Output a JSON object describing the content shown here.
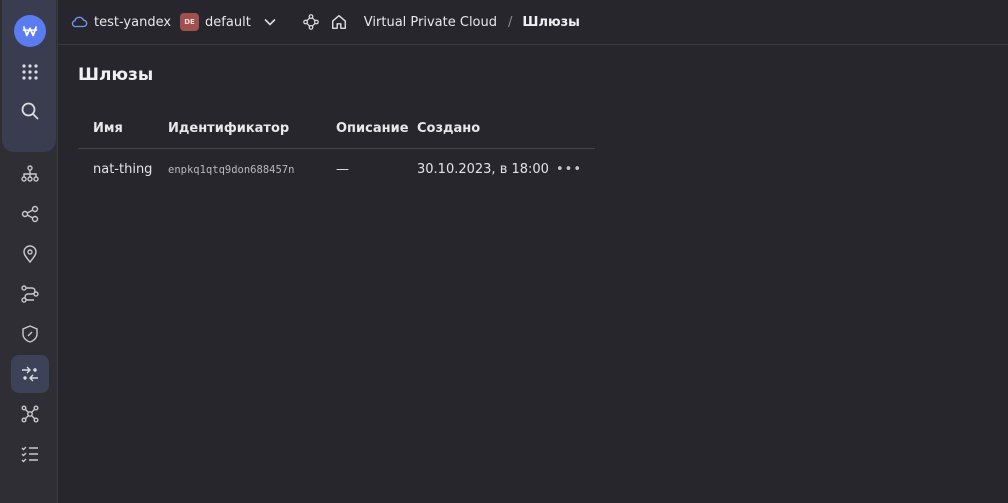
{
  "header": {
    "cloud_name": "test-yandex",
    "folder_badge": "DE",
    "folder_name": "default",
    "breadcrumb_service": "Virtual Private Cloud",
    "breadcrumb_separator": "/",
    "breadcrumb_current": "Шлюзы"
  },
  "sidebar": {
    "items": [
      {
        "icon": "services-grid-icon"
      },
      {
        "icon": "search-icon"
      },
      {
        "icon": "cloud-networks-icon"
      },
      {
        "icon": "ip-addresses-icon"
      },
      {
        "icon": "location-pin-icon"
      },
      {
        "icon": "routing-tables-icon"
      },
      {
        "icon": "security-groups-icon"
      },
      {
        "icon": "gateways-icon",
        "active": true
      },
      {
        "icon": "network-topology-icon"
      },
      {
        "icon": "operations-list-icon"
      }
    ]
  },
  "main": {
    "title": "Шлюзы",
    "table": {
      "headers": [
        "Имя",
        "Идентификатор",
        "Описание",
        "Создано"
      ],
      "rows": [
        {
          "name": "nat-thing",
          "id": "enpkq1qtq9don688457n",
          "description": "—",
          "created": "30.10.2023, в 18:00",
          "actions": "•••"
        }
      ]
    }
  },
  "colors": {
    "background": "#27262d",
    "rail": "#2f2e35",
    "logo": "#5a7cf0",
    "badge": "#a0514f",
    "active_item": "#3c4358"
  }
}
